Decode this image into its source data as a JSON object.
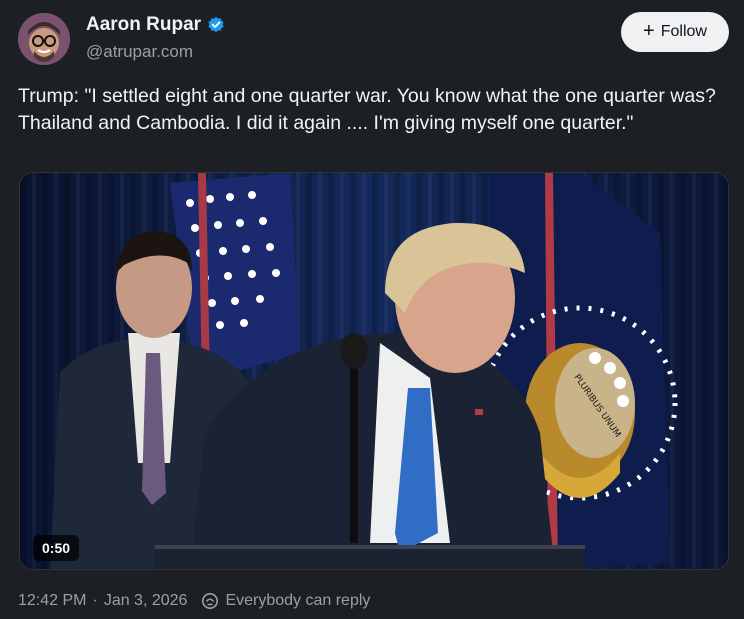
{
  "author": {
    "display_name": "Aaron Rupar",
    "handle": "@atrupar.com",
    "verified_icon": "verified-check-icon",
    "avatar_icon": "avatar-photo"
  },
  "follow_button": {
    "label": "Follow",
    "icon": "plus-icon"
  },
  "post": {
    "text": "Trump: \"I settled eight and one quarter war. You know what the one quarter was? Thailand and Cambodia. I did it again .... I'm giving myself one quarter.\""
  },
  "video": {
    "duration": "0:50",
    "seal_text": "PLURIBUS UNUM"
  },
  "footer": {
    "time": "12:42 PM",
    "separator": "·",
    "date": "Jan 3, 2026",
    "reply_setting": "Everybody can reply",
    "reply_icon": "reply-setting-icon"
  },
  "colors": {
    "background": "#1c1f24",
    "accent_verified": "#1d9bf0",
    "follow_bg": "#eff1f3"
  }
}
